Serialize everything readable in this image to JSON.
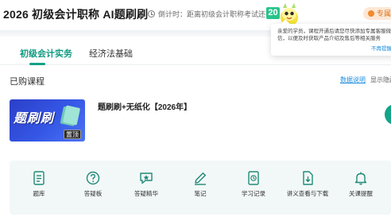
{
  "header": {
    "app_title": "2026 初级会计职称 AI题刷刷",
    "countdown_text": "倒计时：距离初级会计职称考试还有",
    "countdown_days": "20",
    "service_label": "专属"
  },
  "notice": {
    "text": "亲爱的学员，课程开通后请您尽快添加专属客服微信，以便及时获取产品介绍及售后等相关服务",
    "link": "不再提醒"
  },
  "tabs": [
    {
      "label": "初级会计实务",
      "active": true
    },
    {
      "label": "经济法基础",
      "active": false
    }
  ],
  "courses_section": {
    "title": "已购课程",
    "data_desc_link": "数据说明",
    "show_hidden": "显示隐藏"
  },
  "course": {
    "cover_text": "题刷刷",
    "pin_badge": "置顶",
    "name": "题刷刷+无纸化【2026年】"
  },
  "functions": [
    {
      "label": "题库",
      "icon": "question-bank-icon"
    },
    {
      "label": "答疑板",
      "icon": "qa-board-icon"
    },
    {
      "label": "答疑精华",
      "icon": "qa-highlights-icon"
    },
    {
      "label": "笔记",
      "icon": "notes-icon"
    },
    {
      "label": "学习记录",
      "icon": "study-record-icon"
    },
    {
      "label": "讲义查看与下载",
      "icon": "handout-download-icon"
    },
    {
      "label": "关课提醒",
      "icon": "course-reminder-icon"
    }
  ],
  "colors": {
    "accent": "#12a187",
    "badge_green": "#28c48b",
    "link_blue": "#1d8fe0",
    "service_orange": "#d8741c"
  }
}
